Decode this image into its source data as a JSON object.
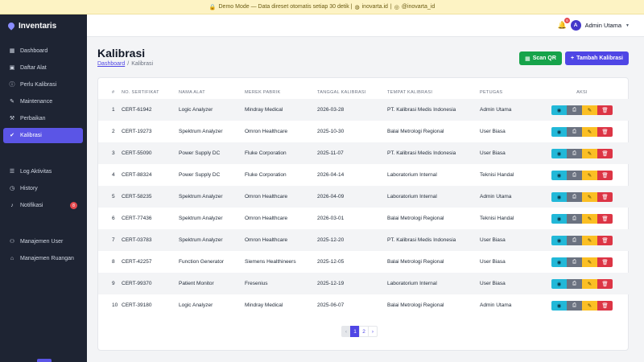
{
  "banner": {
    "lock_icon": "lock-icon",
    "text": "Demo Mode — Data direset otomatis setiap 30 detik |",
    "site": "inovarta.id",
    "sep": "|",
    "handle": "@inovarta_id"
  },
  "app": {
    "name": "Inventaris"
  },
  "sidebar": {
    "items": [
      {
        "label": "Dashboard",
        "icon": "grid-icon"
      },
      {
        "label": "Daftar Alat",
        "icon": "box-icon"
      },
      {
        "label": "Perlu Kalibrasi",
        "icon": "alert-circle-icon"
      },
      {
        "label": "Maintenance",
        "icon": "wrench-icon"
      },
      {
        "label": "Perbaikan",
        "icon": "tools-icon"
      },
      {
        "label": "Kalibrasi",
        "icon": "check-badge-icon",
        "active": true
      },
      {
        "label": "Log Aktivitas",
        "icon": "list-icon"
      },
      {
        "label": "History",
        "icon": "clock-icon"
      },
      {
        "label": "Notifikasi",
        "icon": "bell-icon",
        "badge": "8"
      },
      {
        "label": "Manajemen User",
        "icon": "users-icon"
      },
      {
        "label": "Manajemen Ruangan",
        "icon": "door-icon"
      }
    ]
  },
  "topbar": {
    "notif_count": "6",
    "user_initial": "A",
    "user_name": "Admin Utama"
  },
  "page": {
    "title": "Kalibrasi",
    "breadcrumb_home": "Dashboard",
    "breadcrumb_sep": "/",
    "breadcrumb_current": "Kalibrasi"
  },
  "buttons": {
    "scan_qr": "Scan QR",
    "add": "Tambah Kalibrasi"
  },
  "table": {
    "headers": [
      "#",
      "NO. SERTIFIKAT",
      "NAMA ALAT",
      "MEREK PABRIK",
      "TANGGAL KALIBRASI",
      "TEMPAT KALIBRASI",
      "PETUGAS",
      "AKSI"
    ],
    "rows": [
      [
        "1",
        "CERT-61942",
        "Logic Analyzer",
        "Mindray Medical",
        "2026-03-28",
        "PT. Kalibrasi Medis Indonesia",
        "Admin Utama"
      ],
      [
        "2",
        "CERT-19273",
        "Spektrum Analyzer",
        "Omron Healthcare",
        "2025-10-30",
        "Balai Metrologi Regional",
        "User Biasa"
      ],
      [
        "3",
        "CERT-55090",
        "Power Supply DC",
        "Fluke Corporation",
        "2025-11-07",
        "PT. Kalibrasi Medis Indonesia",
        "User Biasa"
      ],
      [
        "4",
        "CERT-88324",
        "Power Supply DC",
        "Fluke Corporation",
        "2026-04-14",
        "Laboratorium Internal",
        "Teknisi Handal"
      ],
      [
        "5",
        "CERT-58235",
        "Spektrum Analyzer",
        "Omron Healthcare",
        "2026-04-09",
        "Laboratorium Internal",
        "Admin Utama"
      ],
      [
        "6",
        "CERT-77436",
        "Spektrum Analyzer",
        "Omron Healthcare",
        "2026-03-01",
        "Balai Metrologi Regional",
        "Teknisi Handal"
      ],
      [
        "7",
        "CERT-03783",
        "Spektrum Analyzer",
        "Omron Healthcare",
        "2025-12-20",
        "PT. Kalibrasi Medis Indonesia",
        "User Biasa"
      ],
      [
        "8",
        "CERT-42257",
        "Function Generator",
        "Siemens Healthineers",
        "2025-12-05",
        "Balai Metrologi Regional",
        "User Biasa"
      ],
      [
        "9",
        "CERT-99370",
        "Patient Monitor",
        "Fresenius",
        "2025-12-19",
        "Laboratorium Internal",
        "User Biasa"
      ],
      [
        "10",
        "CERT-39180",
        "Logic Analyzer",
        "Mindray Medical",
        "2025-06-07",
        "Balai Metrologi Regional",
        "Admin Utama"
      ]
    ]
  },
  "pagination": {
    "prev": "‹",
    "pages": [
      "1",
      "2"
    ],
    "current": "1",
    "next": "›"
  },
  "colors": {
    "sidebar_bg": "#1e2433",
    "accent": "#5b55e6",
    "success": "#16a34a",
    "danger": "#dc3545",
    "warning": "#fbbf24",
    "info": "#22b8d8"
  }
}
